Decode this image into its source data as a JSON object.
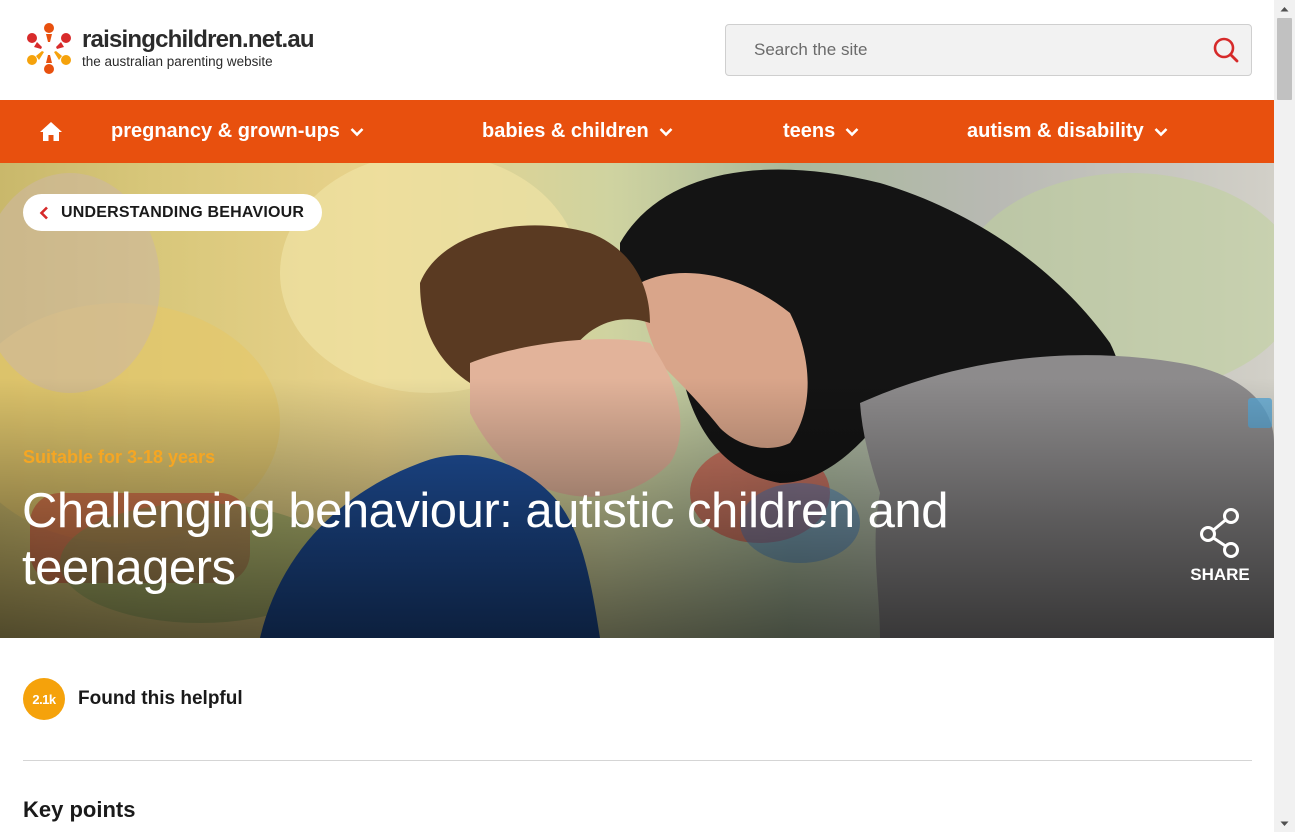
{
  "brand": {
    "name": "raisingchildren.net.au",
    "tagline": "the australian parenting website"
  },
  "search": {
    "placeholder": "Search the site",
    "value": ""
  },
  "nav": {
    "home_icon": "home-icon",
    "items": [
      {
        "label": "pregnancy & grown-ups"
      },
      {
        "label": "babies & children"
      },
      {
        "label": "teens"
      },
      {
        "label": "autism & disability"
      }
    ]
  },
  "hero": {
    "breadcrumb": "UNDERSTANDING BEHAVIOUR",
    "age_label": "Suitable for 3-18 years",
    "title": "Challenging behaviour: autistic children and teenagers",
    "share_label": "SHARE"
  },
  "helpful": {
    "count": "2.1k",
    "label": "Found this helpful"
  },
  "content": {
    "section_heading": "Key points"
  },
  "colors": {
    "nav_orange": "#e8500e",
    "accent_yellow": "#f5a20b",
    "search_icon_red": "#d62a2a"
  }
}
